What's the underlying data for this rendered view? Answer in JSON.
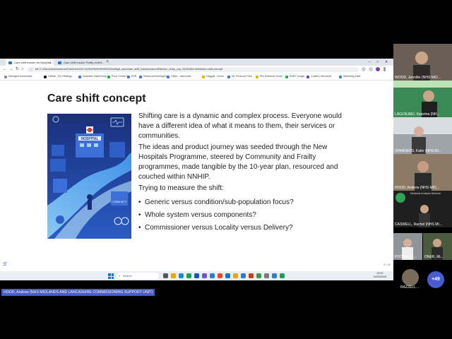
{
  "browser": {
    "tabs": [
      {
        "label": "Care shift tracker for Neighbo..."
      },
      {
        "label": "Care shift tracker Frailty extrn..."
      }
    ],
    "new_tab": "+",
    "window_controls": [
      "–",
      "□",
      "✕"
    ],
    "url": "file   C:/Users/AndrewHood/OneDrive%20-%20NHS/NHIP/elf%20shift/git_repo/care_shift_tracker/care/off/tracker_nhbp_ccp_20260304.html#care-shift-concept",
    "bookmarks": [
      "Managed bookmarks",
      "GitHub_The Strategy...",
      "Available Data/Group",
      "Pivot Convert",
      "ESR",
      "Resource/Nursing/Co...",
      "Ollyer - data tools...",
      "Haggall - Home",
      "ML Personal Files",
      "PBI Personal Home...",
      "EARY Jungle",
      "Copilot | Microsoft",
      "Marketing Data"
    ],
    "nav": {
      "back": "←",
      "forward": "→",
      "reload": "↻",
      "home": "⌂"
    }
  },
  "slide": {
    "title": "Care shift concept",
    "paragraphs": [
      "Shifting care is a dynamic and complex process. Everyone would have a different idea of what it means to them, their services or communities.",
      "The ideas and product journey was seeded through the New Hospitals Programme, steered by Community and Frailty programmes, made tangible by the 10-year plan, resourced and couched within NNHIP.",
      "Trying to measure the shift:"
    ],
    "bullets": [
      "Generic versus condition/sub-population focus?",
      "Whole system versus components?",
      "Commissioner versus Locality versus Delivery?"
    ],
    "illustration": {
      "hospital_sign": "HOSPITAL",
      "community_sign": "COMMUNITY"
    },
    "page_indicator": "5 / 11",
    "menu_icon": "☰"
  },
  "taskbar": {
    "search_placeholder": "Search",
    "time": "09:00",
    "date": "04/03/2026"
  },
  "participants": [
    {
      "name": "WOOD, Jennifer (NHS MID..."
    },
    {
      "name": "LAGUNJAKI, Katerina (NH..."
    },
    {
      "name": "SPANNERS, Katie (NHS MI..."
    },
    {
      "name": "HOOD, Andrew (NHS MID..."
    },
    {
      "name": "CASWELL, Rachel (NHS MI...",
      "tile_text": "Midlands Analysts Network"
    },
    {
      "name": "POTTER, A..."
    },
    {
      "name": "ONER, Mi..."
    }
  ],
  "more_participants": "+49",
  "extra_participant": "RAZZELL...",
  "active_speaker": "HOOD, Andrew (NHS MIDLANDS AND LANCASHIRE COMMISSIONING SUPPORT UNIT)",
  "colors": {
    "accent": "#4a5bd1",
    "slide_bg": "#ffffff",
    "illustration_bg": "#1f3f94"
  }
}
